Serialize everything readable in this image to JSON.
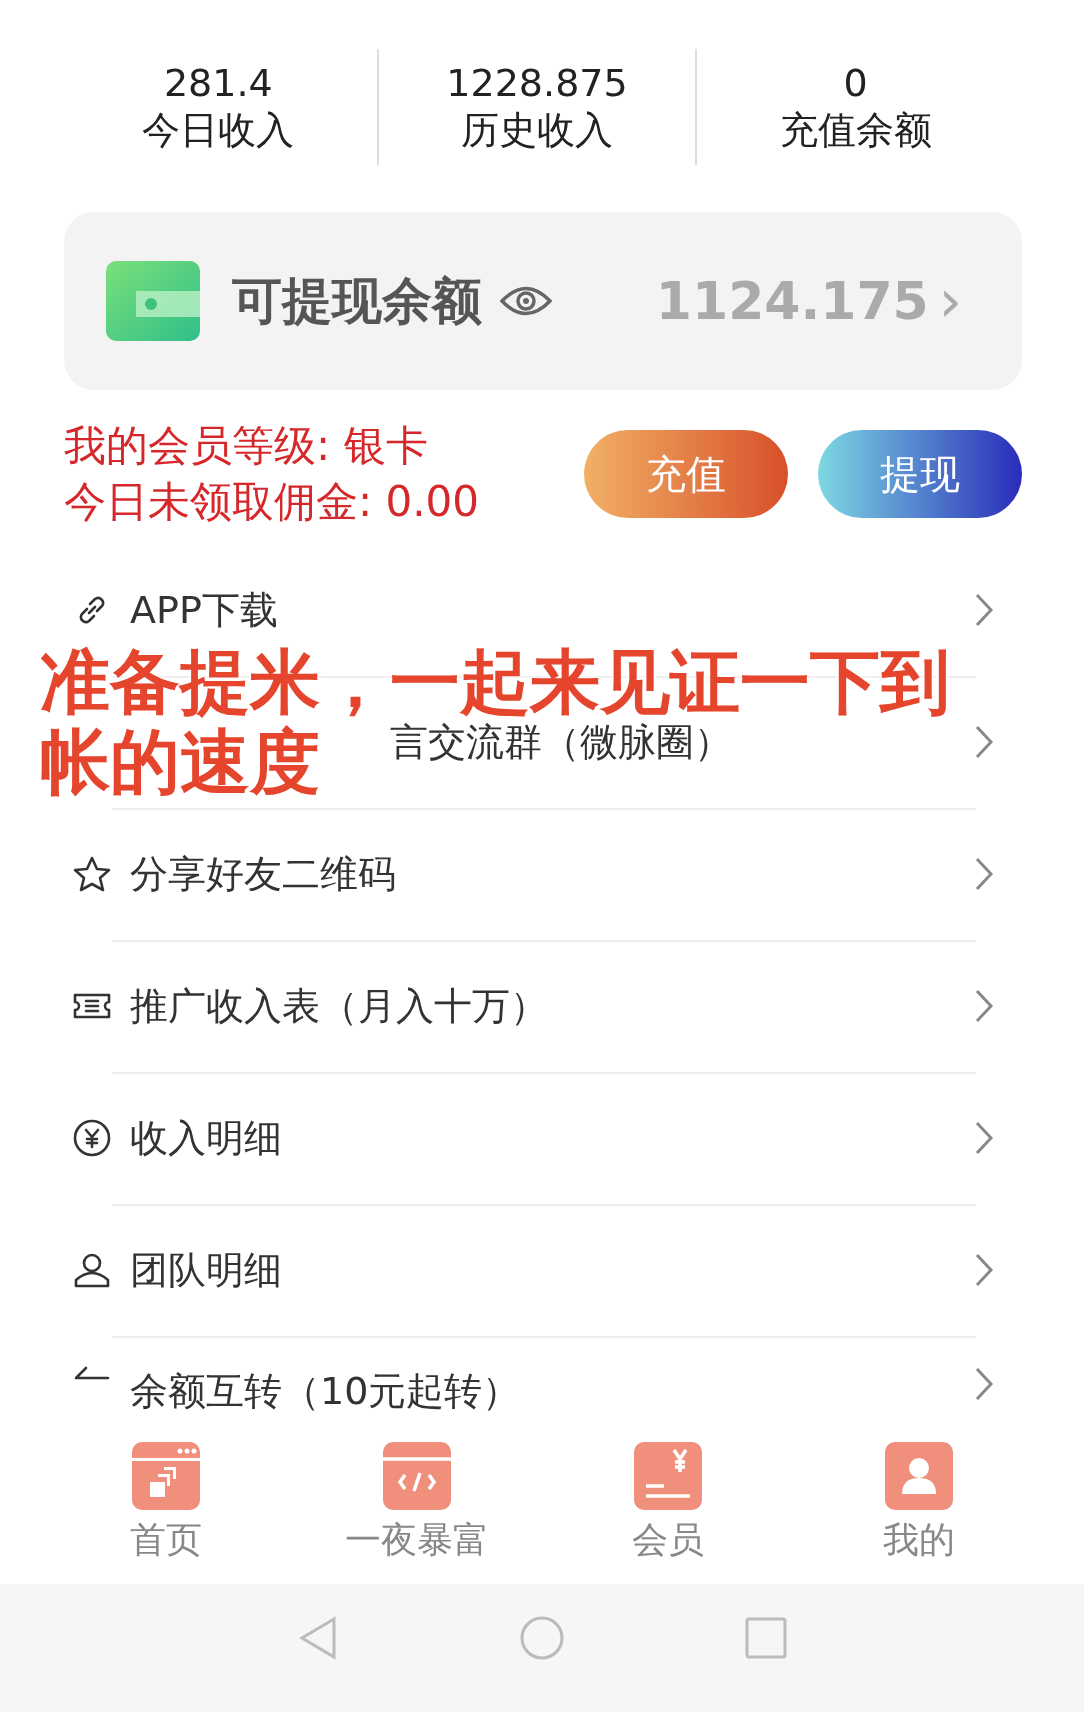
{
  "stats": [
    {
      "value": "281.4",
      "label": "今日收入"
    },
    {
      "value": "1228.875",
      "label": "历史收入"
    },
    {
      "value": "0",
      "label": "充值余额"
    }
  ],
  "balance_card": {
    "title": "可提现余额",
    "amount": "1124.175",
    "chevron": "›"
  },
  "member": {
    "level_line": "我的会员等级: 银卡",
    "commission_line": "今日未领取佣金: 0.00"
  },
  "buttons": [
    {
      "label": "充值",
      "kind": "warm"
    },
    {
      "label": "提现",
      "kind": "cool"
    }
  ],
  "menu": [
    {
      "label": "APP下载",
      "kind": "normal"
    },
    {
      "label": "言交流群（微脉圈）",
      "kind": "covered"
    },
    {
      "label": "分享好友二维码",
      "kind": "normal"
    },
    {
      "label": "推广收入表（月入十万）",
      "kind": "normal"
    },
    {
      "label": "收入明细",
      "kind": "normal"
    },
    {
      "label": "团队明细",
      "kind": "normal"
    },
    {
      "label": "余额互转（10元起转）",
      "kind": "cut"
    }
  ],
  "caption_lines": [
    "准备提米，一起来见证一下到",
    "帐的速度"
  ],
  "tab_bar": [
    {
      "label": "首页"
    },
    {
      "label": "一夜暴富"
    },
    {
      "label": "会员"
    },
    {
      "label": "我的"
    }
  ]
}
